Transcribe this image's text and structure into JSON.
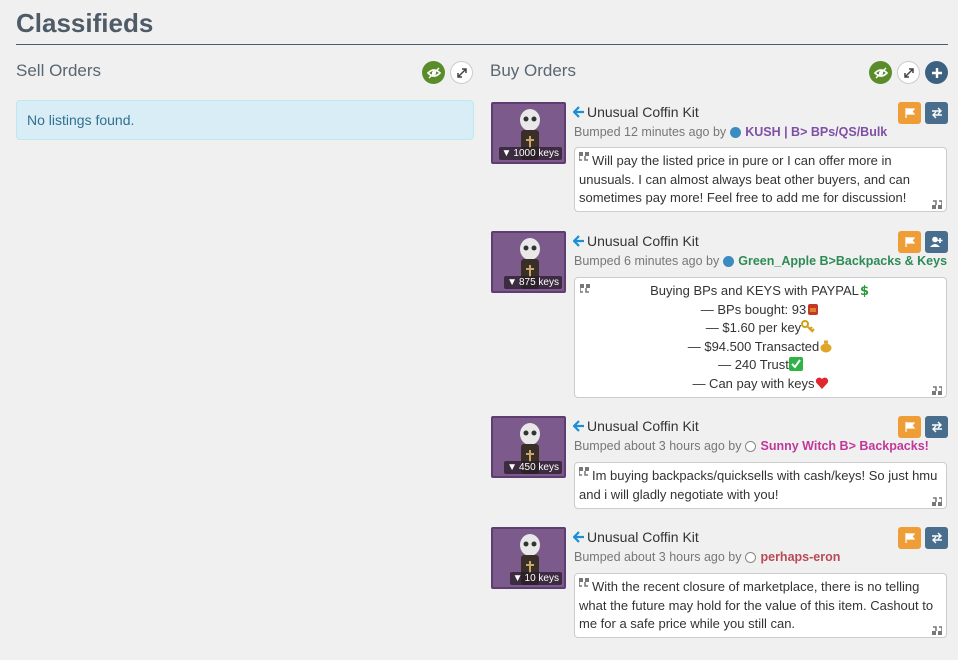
{
  "page": {
    "title": "Classifieds"
  },
  "sell": {
    "title": "Sell Orders",
    "empty_text": "No listings found."
  },
  "buy": {
    "title": "Buy Orders",
    "listings": [
      {
        "item": "Unusual Coffin Kit",
        "price": "1000 keys",
        "bumped": "Bumped 12 minutes ago by",
        "user": "KUSH | B> BPs/QS/Bulk",
        "user_color": "#7f4fa6",
        "status": "online",
        "message": "Will pay the listed price in pure or I can offer more in unusuals. I can almost always beat other buyers, and can sometimes pay more! Feel free to add me for discussion!",
        "secondary_icon": "exchange-icon"
      },
      {
        "item": "Unusual Coffin Kit",
        "price": "875 keys",
        "bumped": "Bumped 6 minutes ago by",
        "user": "Green_Apple B>Backpacks & Keys",
        "user_color": "#2e8b57",
        "status": "online",
        "message_lines": [
          "Buying BPs and KEYS with PAYPAL",
          "— BPs bought: 93",
          "— $1.60 per key",
          "— $94.500 Transacted",
          "— 240 Trust",
          "— Can pay with keys"
        ],
        "secondary_icon": "add-friend-icon"
      },
      {
        "item": "Unusual Coffin Kit",
        "price": "450 keys",
        "bumped": "Bumped about 3 hours ago by",
        "user": "Sunny Witch B> Backpacks!",
        "user_color": "#c2379b",
        "status": "offline",
        "message": "Im buying backpacks/quicksells with cash/keys! So just hmu and i will gladly negotiate with you!",
        "secondary_icon": "exchange-icon"
      },
      {
        "item": "Unusual Coffin Kit",
        "price": "10 keys",
        "bumped": "Bumped about 3 hours ago by",
        "user": "perhaps-eron",
        "user_color": "#b84a55",
        "status": "offline",
        "message": "With the recent closure of marketplace, there is no telling what the future may hold for the value of this item. Cashout to me for a safe price while you still can.",
        "secondary_icon": "exchange-icon"
      }
    ]
  },
  "colors": {
    "accent_green": "#5b8c2a",
    "accent_navy": "#3d6281",
    "flag_orange": "#ef9d36",
    "link_blue": "#1a8fd6"
  }
}
